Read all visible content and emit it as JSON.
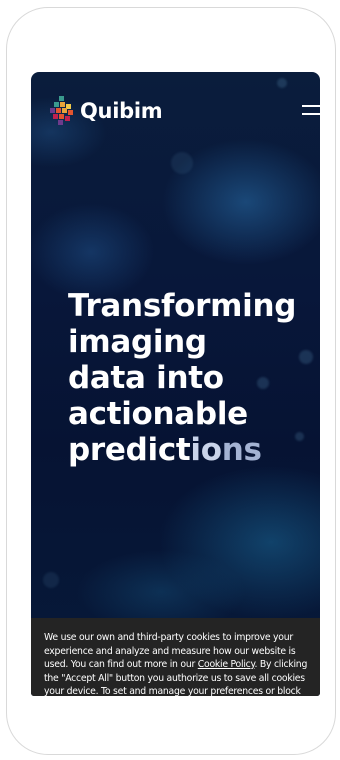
{
  "brand": {
    "name": "Quibim",
    "logo_icon": "quibim-pixel-diamond-icon",
    "logo_colors": [
      "#e8a43a",
      "#e2552f",
      "#c2204f",
      "#6d3b8c",
      "#3a9a8e",
      "#f0c94a"
    ]
  },
  "header": {
    "menu_icon": "hamburger-menu-icon"
  },
  "hero": {
    "title_lines": [
      "Transforming",
      "imaging",
      "data into",
      "actionable"
    ],
    "title_last_line": {
      "part1": "predict",
      "part2": "io",
      "part3": "ns"
    }
  },
  "cookie_banner": {
    "line1": "We use our own and third-party cookies to improve your",
    "line2": "experience and analyze and measure how our website is",
    "line3_before_link": "used. You can find out more in our ",
    "link_text": "Cookie Policy",
    "line3_after_link": ". By clicking",
    "line4": "the \"Accept All\" button you authorize us to save all cookies",
    "line5": "your device. To set and manage your preferences or block"
  },
  "colors": {
    "hero_background": "#08173a",
    "banner_background": "#242424",
    "text": "#ffffff"
  }
}
